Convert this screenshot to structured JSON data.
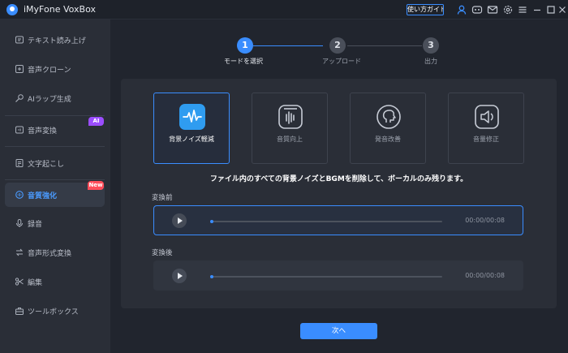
{
  "window": {
    "title": "iMyFone VoxBox",
    "guide_button": "使い方ガイド",
    "icons": [
      "user-icon",
      "discord-icon",
      "mail-icon",
      "settings-icon",
      "menu-icon",
      "minimize-icon",
      "maximize-icon",
      "close-icon"
    ]
  },
  "sidebar": {
    "items": [
      {
        "label": "テキスト読み上げ",
        "icon": "speaker-icon"
      },
      {
        "label": "音声クローン",
        "icon": "clone-icon"
      },
      {
        "label": "AIラップ生成",
        "icon": "rap-icon"
      },
      {
        "label": "音声変換",
        "icon": "voice-change-icon",
        "badge": "AI"
      },
      {
        "label": "文字起こし",
        "icon": "transcribe-icon"
      },
      {
        "label": "音質強化",
        "icon": "enhance-icon",
        "badge": "New",
        "active": true
      },
      {
        "label": "録音",
        "icon": "mic-icon"
      },
      {
        "label": "音声形式変換",
        "icon": "convert-icon"
      },
      {
        "label": "編集",
        "icon": "scissors-icon"
      },
      {
        "label": "ツールボックス",
        "icon": "toolbox-icon"
      }
    ]
  },
  "steps": [
    {
      "number": "1",
      "label": "モードを選択",
      "state": "current"
    },
    {
      "number": "2",
      "label": "アップロード",
      "state": "todo"
    },
    {
      "number": "3",
      "label": "出力",
      "state": "todo"
    }
  ],
  "modes": [
    {
      "label": "背景ノイズ軽減",
      "icon": "noise-reduction-icon",
      "selected": true
    },
    {
      "label": "音質向上",
      "icon": "quality-icon",
      "selected": false
    },
    {
      "label": "発音改善",
      "icon": "pronunciation-icon",
      "selected": false
    },
    {
      "label": "音量修正",
      "icon": "volume-icon",
      "selected": false
    }
  ],
  "description": "ファイル内のすべての背景ノイズとBGMを削除して、ボーカルのみ残ります。",
  "before": {
    "label": "変換前",
    "time": "00:00/00:08",
    "progress": 0
  },
  "after": {
    "label": "変換後",
    "time": "00:00/00:08",
    "progress": 0
  },
  "next_button": "次へ",
  "colors": {
    "accent": "#3a8dff",
    "ai_badge": "#9b4dff",
    "new_badge": "#ff4d5a",
    "background": "#21252e",
    "sidebar": "#2a2e37"
  }
}
